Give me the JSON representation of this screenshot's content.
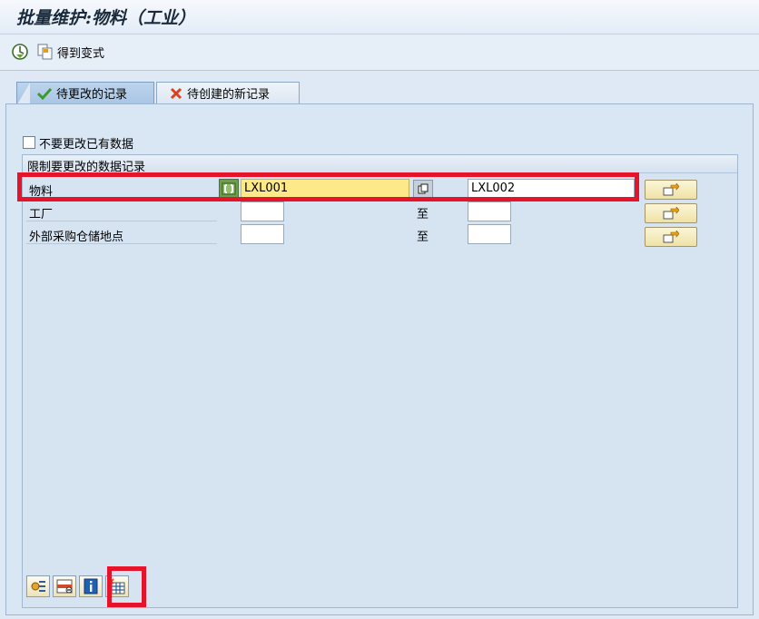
{
  "title": "批量维护:物料（工业）",
  "toolbar": {
    "execute_icon": "execute-clock-icon",
    "get_variant_label": "得到变式"
  },
  "tabs": [
    {
      "label": "待更改的记录",
      "icon": "checkmark-icon",
      "active": true
    },
    {
      "label": "待创建的新记录",
      "icon": "red-x-icon",
      "active": false
    }
  ],
  "no_change_checkbox": {
    "label": "不要更改已有数据",
    "checked": false
  },
  "restrict_group": {
    "title": "限制要更改的数据记录",
    "to_label": "至",
    "rows": [
      {
        "label": "物料",
        "from": "LXL001",
        "to": "LXL002"
      },
      {
        "label": "工厂",
        "from": "",
        "to": ""
      },
      {
        "label": "外部采购仓储地点",
        "from": "",
        "to": ""
      }
    ]
  },
  "bottom_buttons": [
    {
      "icon": "variant-settings-icon"
    },
    {
      "icon": "delete-row-icon"
    },
    {
      "icon": "info-icon"
    },
    {
      "icon": "table-select-icon"
    }
  ],
  "colors": {
    "highlight_frame": "#e5142a",
    "active_field": "#fde98a",
    "background": "#dfe9f5"
  }
}
